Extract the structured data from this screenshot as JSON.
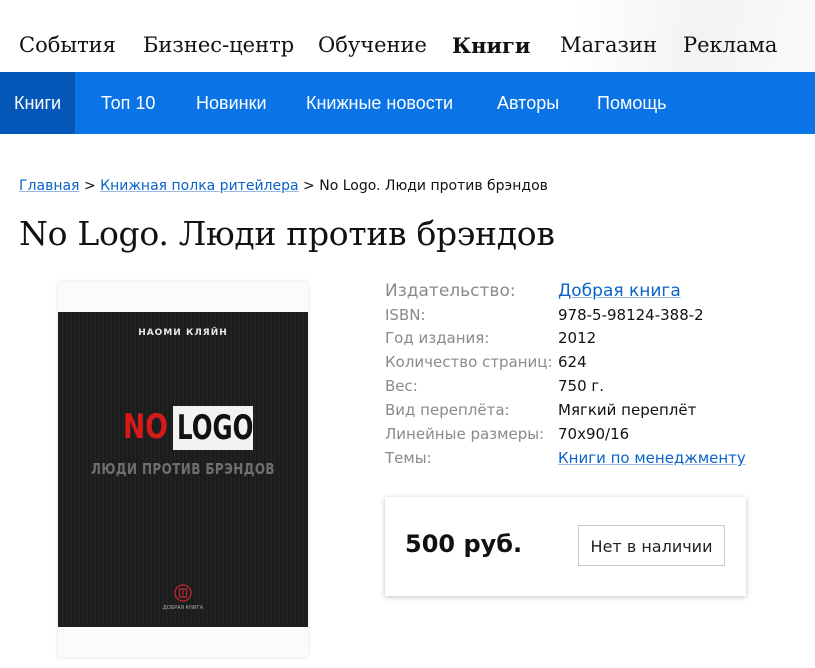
{
  "top_nav": {
    "items": [
      {
        "label": "События"
      },
      {
        "label": "Бизнес-центр"
      },
      {
        "label": "Обучение"
      },
      {
        "label": "Книги",
        "active": true
      },
      {
        "label": "Магазин"
      },
      {
        "label": "Реклама"
      }
    ]
  },
  "sub_nav": {
    "items": [
      {
        "label": "Книги",
        "active": true
      },
      {
        "label": "Топ 10"
      },
      {
        "label": "Новинки"
      },
      {
        "label": "Книжные новости"
      },
      {
        "label": "Авторы"
      },
      {
        "label": "Помощь"
      }
    ],
    "color": "#0a73e6",
    "active_color": "#0557b8"
  },
  "breadcrumb": {
    "home": "Главная",
    "separator": ">",
    "section": "Книжная полка ритейлера",
    "current": "No Logo. Люди против брэндов"
  },
  "page_title": "No Logo. Люди против брэндов",
  "cover": {
    "author": "НАОМИ КЛЯЙН",
    "title_red": "NO",
    "title_box": "LOGO",
    "subtitle": "ЛЮДИ ПРОТИВ БРЭНДОВ",
    "publisher_mark": "ДОБРАЯ КНИГА"
  },
  "details": {
    "publisher_label": "Издательство:",
    "publisher_value": "Добрая книга",
    "isbn_label": "ISBN:",
    "isbn_value": "978-5-98124-388-2",
    "year_label": "Год издания:",
    "year_value": "2012",
    "pages_label": "Количество страниц:",
    "pages_value": "624",
    "weight_label": "Вес:",
    "weight_value": "750 г.",
    "binding_label": "Вид переплёта:",
    "binding_value": "Мягкий переплёт",
    "size_label": "Линейные размеры:",
    "size_value": "70x90/16",
    "topics_label": "Темы:",
    "topics_value": "Книги по менеджменту"
  },
  "purchase": {
    "price": "500 руб.",
    "stock_button": "Нет в наличии"
  }
}
